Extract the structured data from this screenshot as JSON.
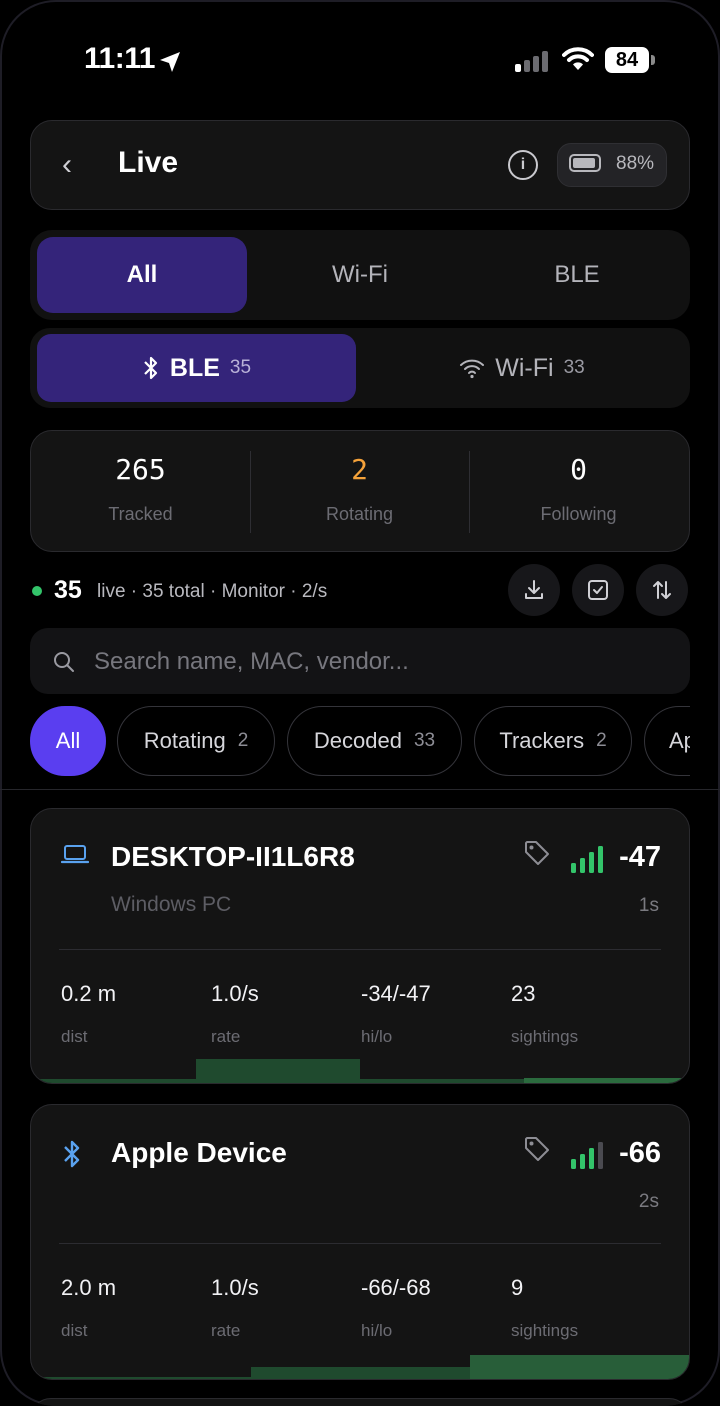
{
  "status_bar": {
    "time": "11:11",
    "battery": "84"
  },
  "header": {
    "title": "Live",
    "battery_pct": "88%"
  },
  "mode_tabs": [
    "All",
    "Wi-Fi",
    "BLE"
  ],
  "radio_tabs": [
    {
      "label": "BLE",
      "count": "35"
    },
    {
      "label": "Wi-Fi",
      "count": "33"
    }
  ],
  "stats": [
    {
      "value": "265",
      "label": "Tracked",
      "color": "#ffffff"
    },
    {
      "value": "2",
      "label": "Rotating",
      "color": "#f5a23a"
    },
    {
      "value": "0",
      "label": "Following",
      "color": "#ffffff"
    }
  ],
  "live": {
    "count": "35",
    "summary": "live · 35 total · Monitor · 2/s"
  },
  "search": {
    "placeholder": "Search name, MAC, vendor..."
  },
  "filters": [
    {
      "label": "All",
      "count": ""
    },
    {
      "label": "Rotating",
      "count": "2"
    },
    {
      "label": "Decoded",
      "count": "33"
    },
    {
      "label": "Trackers",
      "count": "2"
    },
    {
      "label": "Ap",
      "count": ""
    }
  ],
  "devices": [
    {
      "name": "DESKTOP-II1L6R8",
      "subtitle": "Windows PC",
      "icon": "laptop-icon",
      "rssi": "-47",
      "age": "1s",
      "metrics": [
        {
          "value": "0.2 m",
          "label": "dist"
        },
        {
          "value": "1.0/s",
          "label": "rate"
        },
        {
          "value": "-34/-47",
          "label": "hi/lo"
        },
        {
          "value": "23",
          "label": "sightings"
        }
      ]
    },
    {
      "name": "Apple Device",
      "subtitle": "",
      "icon": "bluetooth-icon",
      "rssi": "-66",
      "age": "2s",
      "metrics": [
        {
          "value": "2.0 m",
          "label": "dist"
        },
        {
          "value": "1.0/s",
          "label": "rate"
        },
        {
          "value": "-66/-68",
          "label": "hi/lo"
        },
        {
          "value": "9",
          "label": "sightings"
        }
      ]
    }
  ],
  "colors": {
    "accent": "#34247a",
    "chip_active": "#5a3ef0",
    "signal": "#33c46a",
    "rotating": "#f5a23a"
  }
}
